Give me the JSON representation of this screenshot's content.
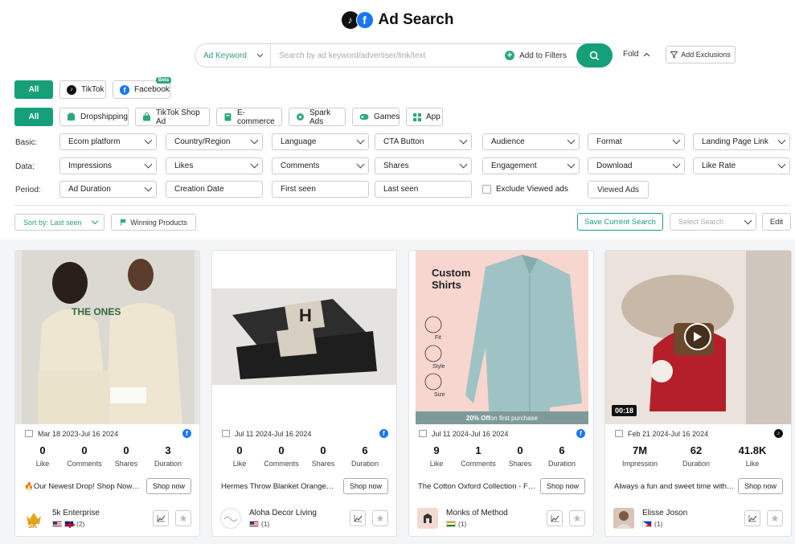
{
  "header": {
    "title": "Ad Search"
  },
  "search": {
    "keyword_select": "Ad Keyword",
    "placeholder": "Search by ad keyword/advertiser/link/text",
    "add_filters": "Add to Filters",
    "fold": "Fold",
    "add_exclusions": "Add Exclusions"
  },
  "platforms": {
    "all": "All",
    "tiktok": "TikTok",
    "facebook": "Facebook",
    "beta": "Beta"
  },
  "categories": {
    "all": "All",
    "items": [
      "Dropshipping",
      "TikTok Shop Ad",
      "E-commerce",
      "Spark Ads",
      "Games",
      "App"
    ]
  },
  "filters": {
    "basic_label": "Basic:",
    "basic": [
      "Ecom platform",
      "Country/Region",
      "Language",
      "CTA Button",
      "Audience",
      "Format",
      "Landing Page Link"
    ],
    "data_label": "Data:",
    "data": [
      "Impressions",
      "Likes",
      "Comments",
      "Shares",
      "Engagement",
      "Download",
      "Like Rate"
    ],
    "period_label": "Period:",
    "period": [
      "Ad Duration",
      "Creation Date",
      "First seen",
      "Last seen"
    ],
    "exclude_viewed": "Exclude Viewed ads",
    "viewed_ads": "Viewed Ads"
  },
  "toolbar": {
    "sort": "Sort by: Last seen",
    "winning": "Winning Products",
    "save_search": "Save Current Search",
    "select_search": "Select Search",
    "edit": "Edit"
  },
  "cards": [
    {
      "date": "Mar 18 2023-Jul 16 2024",
      "platform": "facebook",
      "stats": [
        {
          "v": "0",
          "l": "Like"
        },
        {
          "v": "0",
          "l": "Comments"
        },
        {
          "v": "0",
          "l": "Shares"
        },
        {
          "v": "3",
          "l": "Duration"
        }
      ],
      "text": "🔥Our Newest Drop! Shop Now…",
      "cta": "Shop now",
      "advertiser": "5k Enterprise",
      "count": "(2)",
      "media_label": "THE ONES"
    },
    {
      "date": "Jul 11 2024-Jul 16 2024",
      "platform": "facebook",
      "stats": [
        {
          "v": "0",
          "l": "Like"
        },
        {
          "v": "0",
          "l": "Comments"
        },
        {
          "v": "0",
          "l": "Shares"
        },
        {
          "v": "6",
          "l": "Duration"
        }
      ],
      "text": "Hermes Throw Blanket Orange…",
      "cta": "Shop now",
      "advertiser": "Aloha Decor Living",
      "count": "(1)",
      "media_label": "H"
    },
    {
      "date": "Jul 11 2024-Jul 16 2024",
      "platform": "facebook",
      "stats": [
        {
          "v": "9",
          "l": "Like"
        },
        {
          "v": "1",
          "l": "Comments"
        },
        {
          "v": "0",
          "l": "Shares"
        },
        {
          "v": "6",
          "l": "Duration"
        }
      ],
      "text": "The Cotton Oxford Collection - F…",
      "cta": "Shop now",
      "advertiser": "Monks of Method",
      "count": "(1)",
      "media_title": "Custom Shirts",
      "media_fit": "Fit",
      "media_style": "Style",
      "media_size": "Size",
      "banner_strong": "20% Off",
      "banner_rest": " on first purchase"
    },
    {
      "date": "Feb 21 2024-Jul 16 2024",
      "platform": "tiktok",
      "stats": [
        {
          "v": "7M",
          "l": "Impression"
        },
        {
          "v": "62",
          "l": "Duration"
        },
        {
          "v": "41.8K",
          "l": "Like"
        }
      ],
      "text": "Always a fun and sweet time with…",
      "cta": "Shop now",
      "advertiser": "Elisse Joson",
      "count": "(1)",
      "video_time": "00:18"
    }
  ],
  "colors": {
    "accent": "#16a07a",
    "facebook": "#1877f2",
    "tiktok": "#111111"
  }
}
